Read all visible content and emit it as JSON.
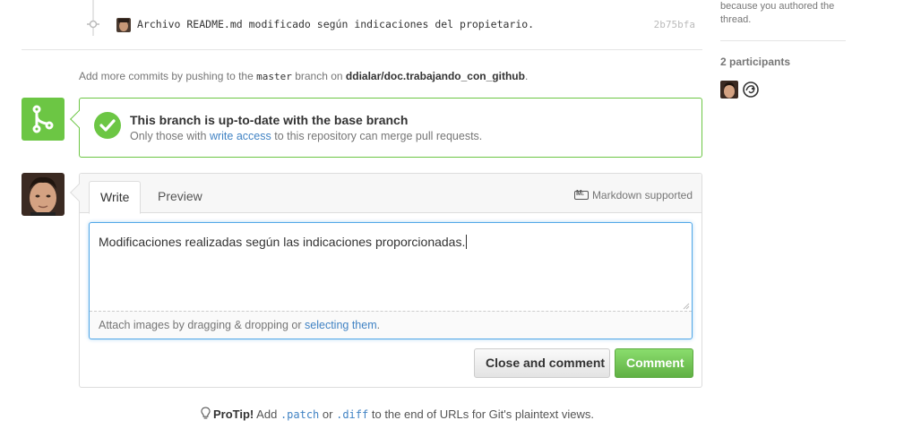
{
  "commit": {
    "message": "Archivo README.md modificado según indicaciones del propietario.",
    "sha": "2b75bfa"
  },
  "push_hint": {
    "prefix": "Add more commits by pushing to the",
    "branch": "master",
    "middle": "branch on",
    "repo": "ddialar/doc.trabajando_con_github",
    "suffix": "."
  },
  "merge": {
    "title": "This branch is up-to-date with the base branch",
    "desc_prefix": "Only those with",
    "desc_link": "write access",
    "desc_suffix": "to this repository can merge pull requests."
  },
  "comment_form": {
    "tabs": [
      "Write",
      "Preview"
    ],
    "markdown_note": "Markdown supported",
    "textarea_value": "Modificaciones realizadas según las indicaciones proporcionadas.",
    "attach_prefix": "Attach images by dragging & dropping or",
    "attach_link": "selecting them",
    "attach_suffix": ".",
    "close_button": "Close and comment",
    "comment_button": "Comment"
  },
  "protip": {
    "label": "ProTip!",
    "prefix": "Add",
    "patch": ".patch",
    "or": "or",
    "diff": ".diff",
    "suffix": "to the end of URLs for Git's plaintext views."
  },
  "sidebar": {
    "notification_note": "because you authored the thread.",
    "participants_title": "2 participants"
  },
  "colors": {
    "success_green": "#6cc644",
    "link_blue": "#4183c4",
    "focus_blue": "#51a7e8"
  },
  "icons": {
    "merge": "git-branch-icon",
    "check": "check-icon",
    "commit": "git-commit-icon",
    "protip": "light-bulb-icon",
    "markdown": "markdown-icon"
  }
}
